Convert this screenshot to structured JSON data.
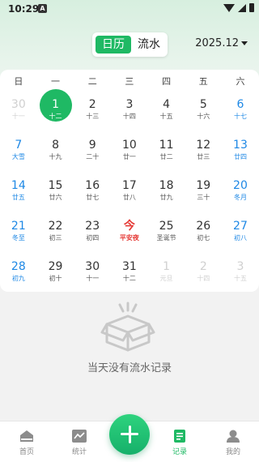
{
  "status_bar": {
    "time": "10:29",
    "badge": "A"
  },
  "header": {
    "segment_calendar": "日历",
    "segment_flow": "流水",
    "month": "2025.12"
  },
  "calendar": {
    "weekdays": [
      "日",
      "一",
      "二",
      "三",
      "四",
      "五",
      "六"
    ],
    "days": [
      {
        "num": "30",
        "lunar": "十一",
        "type": "other"
      },
      {
        "num": "1",
        "lunar": "十二",
        "type": "selected"
      },
      {
        "num": "2",
        "lunar": "十三",
        "type": "normal"
      },
      {
        "num": "3",
        "lunar": "十四",
        "type": "normal"
      },
      {
        "num": "4",
        "lunar": "十五",
        "type": "normal"
      },
      {
        "num": "5",
        "lunar": "十六",
        "type": "normal"
      },
      {
        "num": "6",
        "lunar": "十七",
        "type": "weekend"
      },
      {
        "num": "7",
        "lunar": "大雪",
        "type": "weekend"
      },
      {
        "num": "8",
        "lunar": "十九",
        "type": "normal"
      },
      {
        "num": "9",
        "lunar": "二十",
        "type": "normal"
      },
      {
        "num": "10",
        "lunar": "廿一",
        "type": "normal"
      },
      {
        "num": "11",
        "lunar": "廿二",
        "type": "normal"
      },
      {
        "num": "12",
        "lunar": "廿三",
        "type": "normal"
      },
      {
        "num": "13",
        "lunar": "廿四",
        "type": "weekend"
      },
      {
        "num": "14",
        "lunar": "廿五",
        "type": "weekend"
      },
      {
        "num": "15",
        "lunar": "廿六",
        "type": "normal"
      },
      {
        "num": "16",
        "lunar": "廿七",
        "type": "normal"
      },
      {
        "num": "17",
        "lunar": "廿八",
        "type": "normal"
      },
      {
        "num": "18",
        "lunar": "廿九",
        "type": "normal"
      },
      {
        "num": "19",
        "lunar": "三十",
        "type": "normal"
      },
      {
        "num": "20",
        "lunar": "冬月",
        "type": "weekend"
      },
      {
        "num": "21",
        "lunar": "冬至",
        "type": "weekend"
      },
      {
        "num": "22",
        "lunar": "初三",
        "type": "normal"
      },
      {
        "num": "23",
        "lunar": "初四",
        "type": "normal"
      },
      {
        "num": "今",
        "lunar": "平安夜",
        "type": "festival"
      },
      {
        "num": "25",
        "lunar": "圣诞节",
        "type": "normal"
      },
      {
        "num": "26",
        "lunar": "初七",
        "type": "normal"
      },
      {
        "num": "27",
        "lunar": "初八",
        "type": "weekend"
      },
      {
        "num": "28",
        "lunar": "初九",
        "type": "weekend"
      },
      {
        "num": "29",
        "lunar": "初十",
        "type": "normal"
      },
      {
        "num": "30",
        "lunar": "十一",
        "type": "normal"
      },
      {
        "num": "31",
        "lunar": "十二",
        "type": "normal"
      },
      {
        "num": "1",
        "lunar": "元旦",
        "type": "other"
      },
      {
        "num": "2",
        "lunar": "十四",
        "type": "other"
      },
      {
        "num": "3",
        "lunar": "十五",
        "type": "other"
      }
    ]
  },
  "empty_state": {
    "text": "当天没有流水记录",
    "icon": "empty-box-icon"
  },
  "tabbar": {
    "home": "首页",
    "stats": "统计",
    "add": "add-icon",
    "records": "记录",
    "mine": "我的"
  },
  "colors": {
    "accent": "#1fb964",
    "weekend": "#1e88e5",
    "festival": "#e53935"
  }
}
